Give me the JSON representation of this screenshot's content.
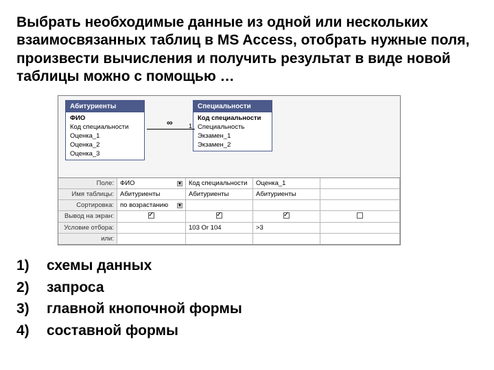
{
  "question": "Выбрать необходимые данные из одной или нескольких взаимосвязанных таблиц в MS Access, отобрать нужные поля, произвести вычисления и получить результат в виде новой таблицы можно с помощью …",
  "tables": {
    "left": {
      "title": "Абитуриенты",
      "fields": [
        "ФИО",
        "Код специальности",
        "Оценка_1",
        "Оценка_2",
        "Оценка_3"
      ],
      "bold_idx": 0
    },
    "right": {
      "title": "Специальности",
      "fields": [
        "Код специальности",
        "Специальность",
        "Экзамен_1",
        "Экзамен_2"
      ],
      "bold_idx": 0
    },
    "rel_left": "∞",
    "rel_right": "1"
  },
  "qbe": {
    "rows": [
      "Поле:",
      "Имя таблицы:",
      "Сортировка:",
      "Вывод на экран:",
      "Условие отбора:",
      "или:"
    ],
    "cols": [
      {
        "field": "ФИО",
        "table": "Абитуриенты",
        "sort": "по возрастанию",
        "show": true,
        "crit": "",
        "or": ""
      },
      {
        "field": "Код специальности",
        "table": "Абитуриенты",
        "sort": "",
        "show": true,
        "crit": "103 Or 104",
        "or": ""
      },
      {
        "field": "Оценка_1",
        "table": "Абитуриенты",
        "sort": "",
        "show": true,
        "crit": ">3",
        "or": ""
      }
    ]
  },
  "answers": [
    {
      "n": "1)",
      "t": "схемы данных"
    },
    {
      "n": "2)",
      "t": "запроса"
    },
    {
      "n": "3)",
      "t": "главной кнопочной формы"
    },
    {
      "n": "4)",
      "t": "составной формы"
    }
  ]
}
